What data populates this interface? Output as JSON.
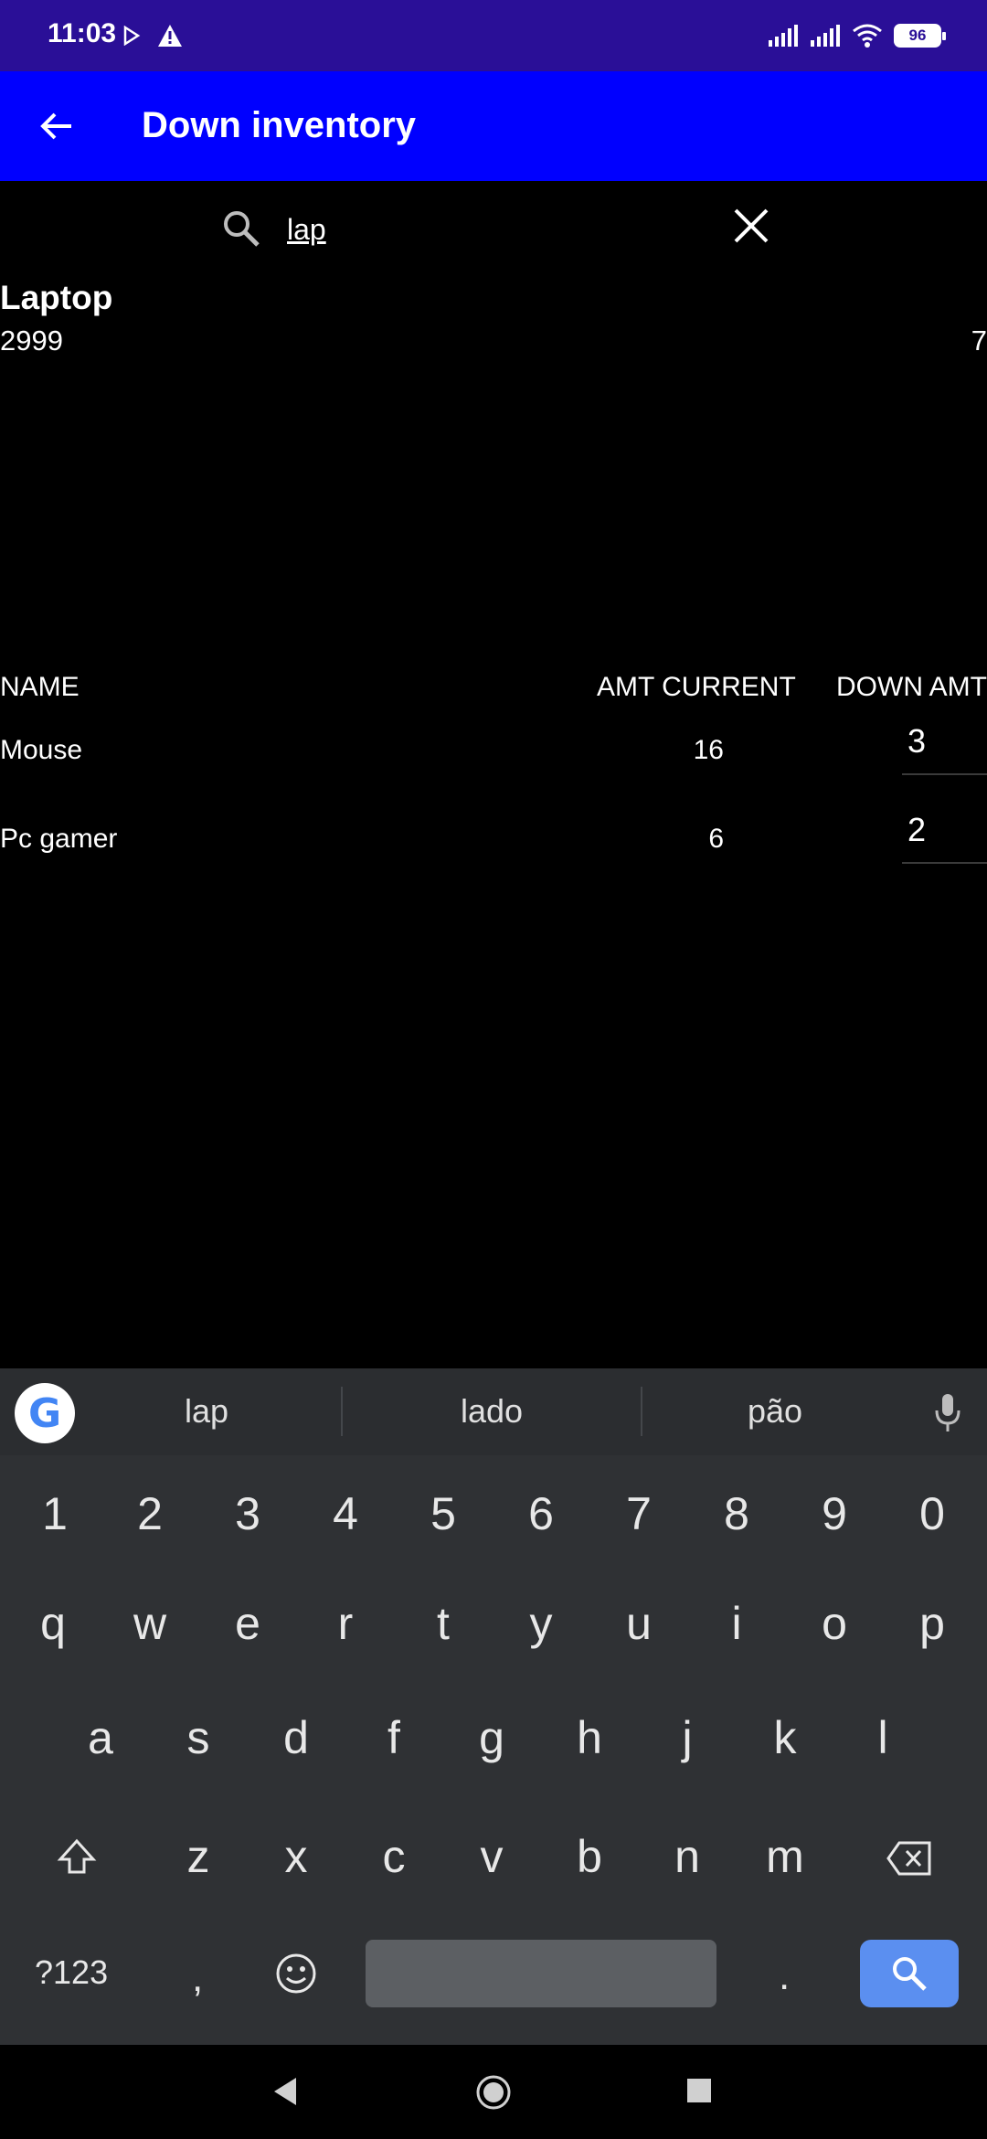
{
  "status": {
    "time": "11:03",
    "battery": "96"
  },
  "appbar": {
    "title": "Down inventory"
  },
  "search": {
    "value": "lap"
  },
  "result": {
    "name": "Laptop",
    "price": "2999",
    "qty": "7"
  },
  "table": {
    "headers": {
      "name": "NAME",
      "current": "AMT CURRENT",
      "down": "DOWN AMT"
    },
    "rows": [
      {
        "name": "Mouse",
        "current": "16",
        "down": "3"
      },
      {
        "name": "Pc gamer",
        "current": "6",
        "down": "2"
      }
    ]
  },
  "keyboard": {
    "suggestions": [
      "lap",
      "lado",
      "pão"
    ],
    "numbers": [
      "1",
      "2",
      "3",
      "4",
      "5",
      "6",
      "7",
      "8",
      "9",
      "0"
    ],
    "row1": [
      "q",
      "w",
      "e",
      "r",
      "t",
      "y",
      "u",
      "i",
      "o",
      "p"
    ],
    "row2": [
      "a",
      "s",
      "d",
      "f",
      "g",
      "h",
      "j",
      "k",
      "l"
    ],
    "row3": [
      "z",
      "x",
      "c",
      "v",
      "b",
      "n",
      "m"
    ],
    "symbols_label": "?123",
    "comma": ",",
    "period": "."
  },
  "colors": {
    "statusbar": "#2a0f97",
    "appbar": "#0000ff",
    "keyboard": "#2f3134",
    "search_key": "#5b8ff0"
  }
}
